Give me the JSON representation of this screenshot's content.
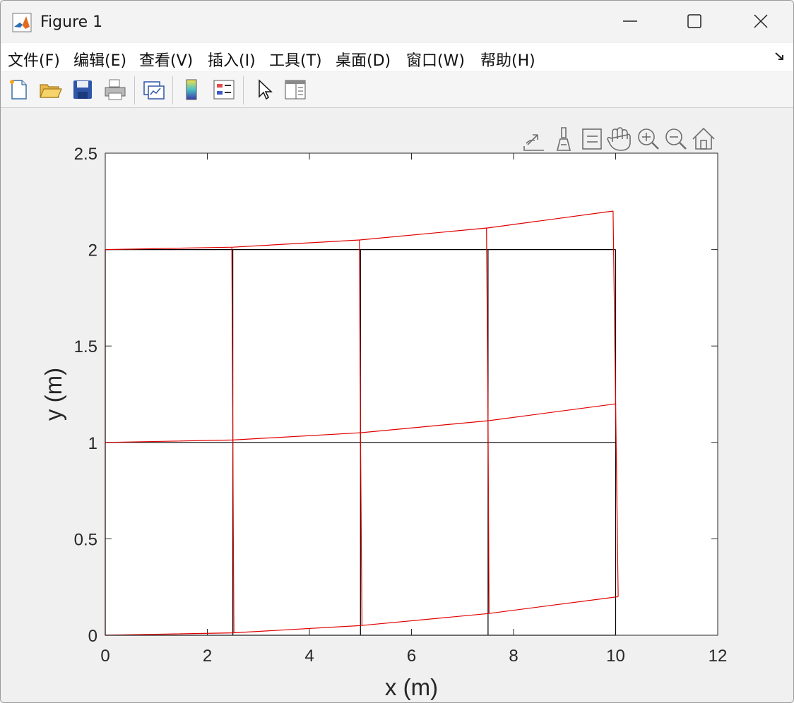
{
  "window": {
    "title": "Figure 1"
  },
  "menu": {
    "items": [
      {
        "label": "文件(F)"
      },
      {
        "label": "编辑(E)"
      },
      {
        "label": "查看(V)"
      },
      {
        "label": "插入(I)"
      },
      {
        "label": "工具(T)"
      },
      {
        "label": "桌面(D)"
      },
      {
        "label": "窗口(W)"
      },
      {
        "label": "帮助(H)"
      }
    ]
  },
  "toolbar": {
    "icons": [
      "new-figure-icon",
      "open-file-icon",
      "save-icon",
      "print-icon",
      "link-plot-icon",
      "colorbar-icon",
      "legend-icon",
      "pointer-icon",
      "property-inspector-icon"
    ]
  },
  "axes_toolbar": {
    "icons": [
      "export-icon",
      "brush-icon",
      "data-tips-icon",
      "pan-icon",
      "zoom-in-icon",
      "zoom-out-icon",
      "home-icon"
    ]
  },
  "colors": {
    "deformed": "#e00000",
    "original": "#000000",
    "axes_bg": "#ffffff"
  },
  "chart_data": {
    "type": "line",
    "title": "",
    "xlabel": "x (m)",
    "ylabel": "y (m)",
    "xlim": [
      0,
      12
    ],
    "ylim": [
      0,
      2.5
    ],
    "xticks": [
      0,
      2,
      4,
      6,
      8,
      10,
      12
    ],
    "yticks": [
      0,
      0.5,
      1,
      1.5,
      2,
      2.5
    ],
    "xtick_labels": [
      "0",
      "2",
      "4",
      "6",
      "8",
      "10",
      "12"
    ],
    "ytick_labels": [
      "0",
      "0.5",
      "1",
      "1.5",
      "2",
      "2.5"
    ],
    "grid": false,
    "series": [
      {
        "color": "#000000",
        "segments": [
          [
            [
              0,
              0
            ],
            [
              10,
              0
            ]
          ],
          [
            [
              0,
              1
            ],
            [
              10,
              1
            ]
          ],
          [
            [
              0,
              2
            ],
            [
              10,
              2
            ]
          ],
          [
            [
              0,
              0
            ],
            [
              0,
              2
            ]
          ],
          [
            [
              2.5,
              0
            ],
            [
              2.5,
              2
            ]
          ],
          [
            [
              5,
              0
            ],
            [
              5,
              2
            ]
          ],
          [
            [
              7.5,
              0
            ],
            [
              7.5,
              2
            ]
          ],
          [
            [
              10,
              0
            ],
            [
              10,
              2
            ]
          ]
        ]
      },
      {
        "color": "#e00000",
        "segments": [
          [
            [
              0,
              0
            ],
            [
              2.5,
              0.0125
            ],
            [
              5,
              0.05
            ],
            [
              7.5,
              0.1125
            ],
            [
              10.05,
              0.2
            ]
          ],
          [
            [
              0,
              1
            ],
            [
              2.5,
              1.0125
            ],
            [
              5,
              1.05
            ],
            [
              7.5,
              1.1125
            ],
            [
              10,
              1.2
            ]
          ],
          [
            [
              0,
              2
            ],
            [
              2.5,
              2.0125
            ],
            [
              5,
              2.05
            ],
            [
              7.5,
              2.1125
            ],
            [
              9.95,
              2.2
            ]
          ],
          [
            [
              0,
              0
            ],
            [
              0,
              1
            ],
            [
              0,
              2
            ]
          ],
          [
            [
              2.52,
              0.0125
            ],
            [
              2.5,
              1.0125
            ],
            [
              2.48,
              2.0125
            ]
          ],
          [
            [
              5.03,
              0.05
            ],
            [
              5,
              1.05
            ],
            [
              4.98,
              2.05
            ]
          ],
          [
            [
              7.52,
              0.1125
            ],
            [
              7.5,
              1.1125
            ],
            [
              7.47,
              2.1125
            ]
          ],
          [
            [
              10.05,
              0.2
            ],
            [
              10,
              1.2
            ],
            [
              9.95,
              2.2
            ]
          ]
        ]
      }
    ]
  }
}
